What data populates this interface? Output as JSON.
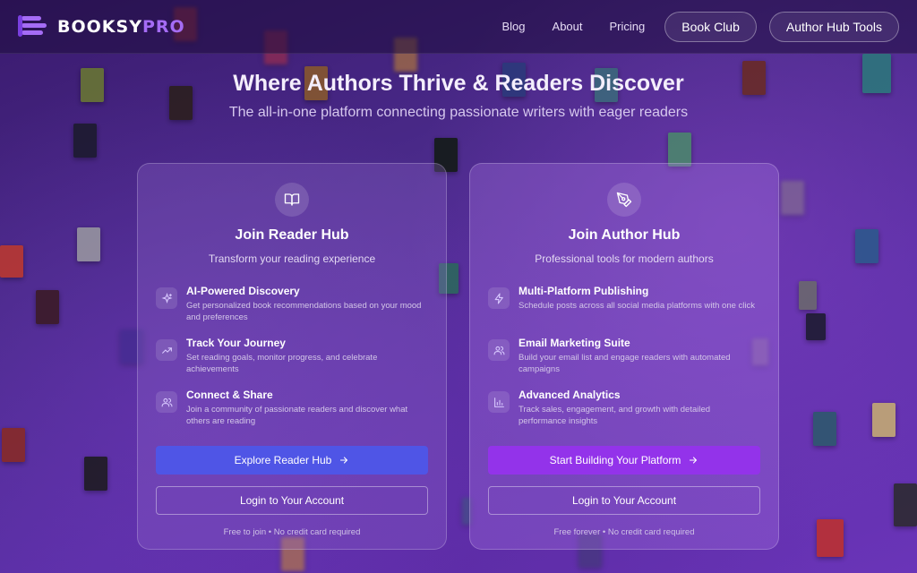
{
  "brand": {
    "name_main": "BOOKSY",
    "name_accent": "PRO",
    "accent_color": "#a56cf5"
  },
  "nav": {
    "links": [
      "Blog",
      "About",
      "Pricing"
    ],
    "book_club": "Book Club",
    "author_tools": "Author Hub Tools"
  },
  "hero": {
    "title": "Where Authors Thrive & Readers Discover",
    "subtitle": "The all-in-one platform connecting passionate writers with eager readers"
  },
  "reader": {
    "icon": "book-open-icon",
    "title": "Join Reader Hub",
    "subtitle": "Transform your reading experience",
    "features": [
      {
        "icon": "sparkles-icon",
        "title": "AI-Powered Discovery",
        "desc": "Get personalized book recommendations based on your mood and preferences"
      },
      {
        "icon": "trending-up-icon",
        "title": "Track Your Journey",
        "desc": "Set reading goals, monitor progress, and celebrate achievements"
      },
      {
        "icon": "users-icon",
        "title": "Connect & Share",
        "desc": "Join a community of passionate readers and discover what others are reading"
      }
    ],
    "primary": "Explore Reader Hub",
    "login": "Login to Your Account",
    "foot": "Free to join • No credit card required",
    "button_color": "#4f55e6"
  },
  "author": {
    "icon": "pen-tool-icon",
    "title": "Join Author Hub",
    "subtitle": "Professional tools for modern authors",
    "features": [
      {
        "icon": "zap-icon",
        "title": "Multi-Platform Publishing",
        "desc": "Schedule posts across all social media platforms with one click"
      },
      {
        "icon": "users-icon",
        "title": "Email Marketing Suite",
        "desc": "Build your email list and engage readers with automated campaigns"
      },
      {
        "icon": "bar-chart-icon",
        "title": "Advanced Analytics",
        "desc": "Track sales, engagement, and growth with detailed performance insights"
      }
    ],
    "primary": "Start Building Your Platform",
    "login": "Login to Your Account",
    "foot": "Free forever • No credit card required",
    "button_color": "#9333ea"
  }
}
